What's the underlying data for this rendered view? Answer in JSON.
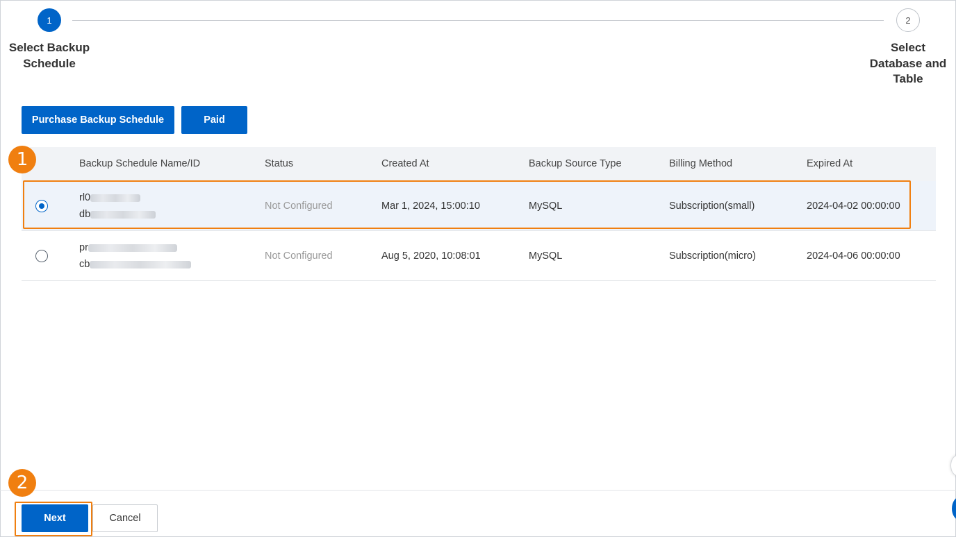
{
  "stepper": {
    "steps": [
      {
        "number": "1",
        "label_line1": "Select Backup",
        "label_line2": "Schedule",
        "state": "active"
      },
      {
        "number": "2",
        "label_line1": "Select",
        "label_line2": "Database and",
        "label_line3": "Table",
        "state": "inactive"
      }
    ]
  },
  "toolbar": {
    "purchase_label": "Purchase Backup Schedule",
    "paid_label": "Paid"
  },
  "table": {
    "columns": [
      "Backup Schedule Name/ID",
      "Status",
      "Created At",
      "Backup Source Type",
      "Billing Method",
      "Expired At"
    ],
    "rows": [
      {
        "selected": true,
        "name_prefix": "rl0",
        "id_prefix": "db",
        "status": "Not Configured",
        "created_at": "Mar 1, 2024, 15:00:10",
        "source_type": "MySQL",
        "billing": "Subscription(small)",
        "expired_at": "2024-04-02 00:00:00"
      },
      {
        "selected": false,
        "name_prefix": "pr",
        "id_prefix": "cb",
        "status": "Not Configured",
        "created_at": "Aug 5, 2020, 10:08:01",
        "source_type": "MySQL",
        "billing": "Subscription(micro)",
        "expired_at": "2024-04-06 00:00:00"
      }
    ]
  },
  "annotations": {
    "badge1": "1",
    "badge2": "2"
  },
  "footer": {
    "next_label": "Next",
    "cancel_label": "Cancel"
  },
  "colors": {
    "primary": "#0064c8",
    "annotation": "#f07f10",
    "selected_row": "#eef3fa"
  }
}
